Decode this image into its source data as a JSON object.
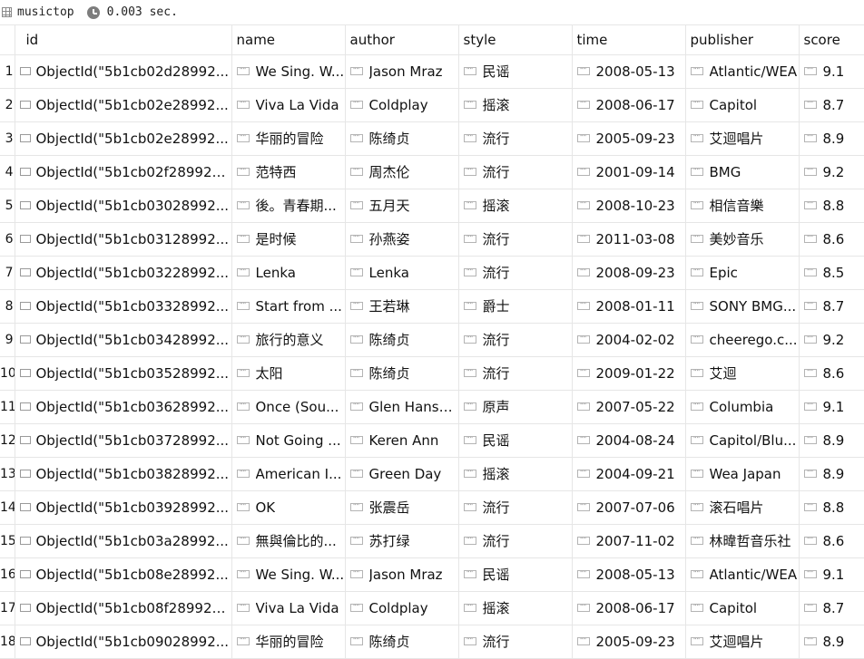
{
  "window": {
    "collection": "musictop",
    "elapsed": "0.003 sec."
  },
  "table": {
    "headers": [
      "id",
      "name",
      "author",
      "style",
      "time",
      "publisher",
      "score"
    ],
    "rows": [
      {
        "num": "1",
        "id": "ObjectId(\"5b1cb02d28992...",
        "name": "We Sing. W...",
        "author": "Jason Mraz",
        "style": "民谣",
        "time": "2008-05-13",
        "publisher": "Atlantic/WEA",
        "score": "9.1"
      },
      {
        "num": "2",
        "id": "ObjectId(\"5b1cb02e28992...",
        "name": "Viva La Vida",
        "author": "Coldplay",
        "style": "摇滚",
        "time": "2008-06-17",
        "publisher": "Capitol",
        "score": "8.7"
      },
      {
        "num": "3",
        "id": "ObjectId(\"5b1cb02e28992...",
        "name": "华丽的冒险",
        "author": "陈绮贞",
        "style": "流行",
        "time": "2005-09-23",
        "publisher": "艾迴唱片",
        "score": "8.9"
      },
      {
        "num": "4",
        "id": "ObjectId(\"5b1cb02f289923...",
        "name": "范特西",
        "author": "周杰伦",
        "style": "流行",
        "time": "2001-09-14",
        "publisher": "BMG",
        "score": "9.2"
      },
      {
        "num": "5",
        "id": "ObjectId(\"5b1cb03028992...",
        "name": "後。青春期...",
        "author": "五月天",
        "style": "摇滚",
        "time": "2008-10-23",
        "publisher": "相信音樂",
        "score": "8.8"
      },
      {
        "num": "6",
        "id": "ObjectId(\"5b1cb03128992...",
        "name": "是时候",
        "author": "孙燕姿",
        "style": "流行",
        "time": "2011-03-08",
        "publisher": "美妙音乐",
        "score": "8.6"
      },
      {
        "num": "7",
        "id": "ObjectId(\"5b1cb03228992...",
        "name": "Lenka",
        "author": "Lenka",
        "style": "流行",
        "time": "2008-09-23",
        "publisher": "Epic",
        "score": "8.5"
      },
      {
        "num": "8",
        "id": "ObjectId(\"5b1cb03328992...",
        "name": "Start from ...",
        "author": "王若琳",
        "style": "爵士",
        "time": "2008-01-11",
        "publisher": "SONY BMG...",
        "score": "8.7"
      },
      {
        "num": "9",
        "id": "ObjectId(\"5b1cb03428992...",
        "name": "旅行的意义",
        "author": "陈绮贞",
        "style": "流行",
        "time": "2004-02-02",
        "publisher": "cheerego.c...",
        "score": "9.2"
      },
      {
        "num": "10",
        "id": "ObjectId(\"5b1cb03528992...",
        "name": "太阳",
        "author": "陈绮贞",
        "style": "流行",
        "time": "2009-01-22",
        "publisher": "艾迴",
        "score": "8.6"
      },
      {
        "num": "11",
        "id": "ObjectId(\"5b1cb03628992...",
        "name": "Once (Sou...",
        "author": "Glen Hansa...",
        "style": "原声",
        "time": "2007-05-22",
        "publisher": "Columbia",
        "score": "9.1"
      },
      {
        "num": "12",
        "id": "ObjectId(\"5b1cb03728992...",
        "name": "Not Going ...",
        "author": "Keren Ann",
        "style": "民谣",
        "time": "2004-08-24",
        "publisher": "Capitol/Blu...",
        "score": "8.9"
      },
      {
        "num": "13",
        "id": "ObjectId(\"5b1cb03828992...",
        "name": "American I...",
        "author": "Green Day",
        "style": "摇滚",
        "time": "2004-09-21",
        "publisher": "Wea Japan",
        "score": "8.9"
      },
      {
        "num": "14",
        "id": "ObjectId(\"5b1cb03928992...",
        "name": "OK",
        "author": "张震岳",
        "style": "流行",
        "time": "2007-07-06",
        "publisher": "滚石唱片",
        "score": "8.8"
      },
      {
        "num": "15",
        "id": "ObjectId(\"5b1cb03a28992...",
        "name": "無與倫比的...",
        "author": "苏打绿",
        "style": "流行",
        "time": "2007-11-02",
        "publisher": "林暐哲音乐社",
        "score": "8.6"
      },
      {
        "num": "16",
        "id": "ObjectId(\"5b1cb08e28992...",
        "name": "We Sing. W...",
        "author": "Jason Mraz",
        "style": "民谣",
        "time": "2008-05-13",
        "publisher": "Atlantic/WEA",
        "score": "9.1"
      },
      {
        "num": "17",
        "id": "ObjectId(\"5b1cb08f289923...",
        "name": "Viva La Vida",
        "author": "Coldplay",
        "style": "摇滚",
        "time": "2008-06-17",
        "publisher": "Capitol",
        "score": "8.7"
      },
      {
        "num": "18",
        "id": "ObjectId(\"5b1cb09028992...",
        "name": "华丽的冒险",
        "author": "陈绮贞",
        "style": "流行",
        "time": "2005-09-23",
        "publisher": "艾迴唱片",
        "score": "8.9"
      }
    ]
  }
}
